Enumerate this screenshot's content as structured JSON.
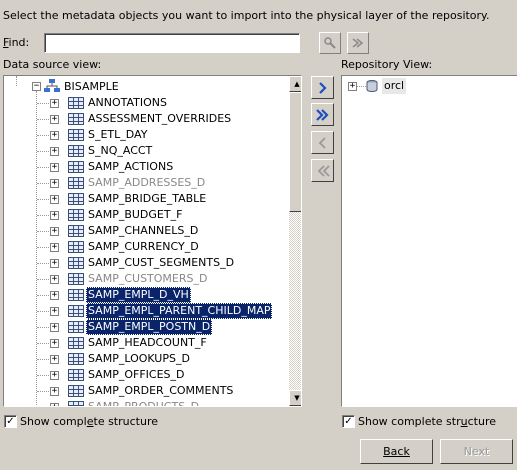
{
  "instructions": "Select the metadata objects you want to import into the physical layer of the repository.",
  "find": {
    "label": "Find:",
    "value": ""
  },
  "left_panel": {
    "label": "Data source view:",
    "root": "BISAMPLE",
    "items": [
      {
        "label": "ANNOTATIONS",
        "state": "normal"
      },
      {
        "label": "ASSESSMENT_OVERRIDES",
        "state": "normal"
      },
      {
        "label": "S_ETL_DAY",
        "state": "normal"
      },
      {
        "label": "S_NQ_ACCT",
        "state": "normal"
      },
      {
        "label": "SAMP_ACTIONS",
        "state": "normal"
      },
      {
        "label": "SAMP_ADDRESSES_D",
        "state": "dim"
      },
      {
        "label": "SAMP_BRIDGE_TABLE",
        "state": "normal"
      },
      {
        "label": "SAMP_BUDGET_F",
        "state": "normal"
      },
      {
        "label": "SAMP_CHANNELS_D",
        "state": "normal"
      },
      {
        "label": "SAMP_CURRENCY_D",
        "state": "normal"
      },
      {
        "label": "SAMP_CUST_SEGMENTS_D",
        "state": "normal"
      },
      {
        "label": "SAMP_CUSTOMERS_D",
        "state": "dim"
      },
      {
        "label": "SAMP_EMPL_D_VH",
        "state": "selected"
      },
      {
        "label": "SAMP_EMPL_PARENT_CHILD_MAP",
        "state": "selected"
      },
      {
        "label": "SAMP_EMPL_POSTN_D",
        "state": "selected"
      },
      {
        "label": "SAMP_HEADCOUNT_F",
        "state": "normal"
      },
      {
        "label": "SAMP_LOOKUPS_D",
        "state": "normal"
      },
      {
        "label": "SAMP_OFFICES_D",
        "state": "normal"
      },
      {
        "label": "SAMP_ORDER_COMMENTS",
        "state": "normal"
      },
      {
        "label": "SAMP_PRODUCTS_D",
        "state": "dim"
      }
    ],
    "show_complete_structure": {
      "label": "Show complete structure",
      "checked": true
    }
  },
  "right_panel": {
    "label": "Repository View:",
    "root": "orcl",
    "show_complete_structure": {
      "label": "Show complete structure",
      "checked": true
    }
  },
  "buttons": {
    "back": "Back",
    "next": "Next"
  }
}
